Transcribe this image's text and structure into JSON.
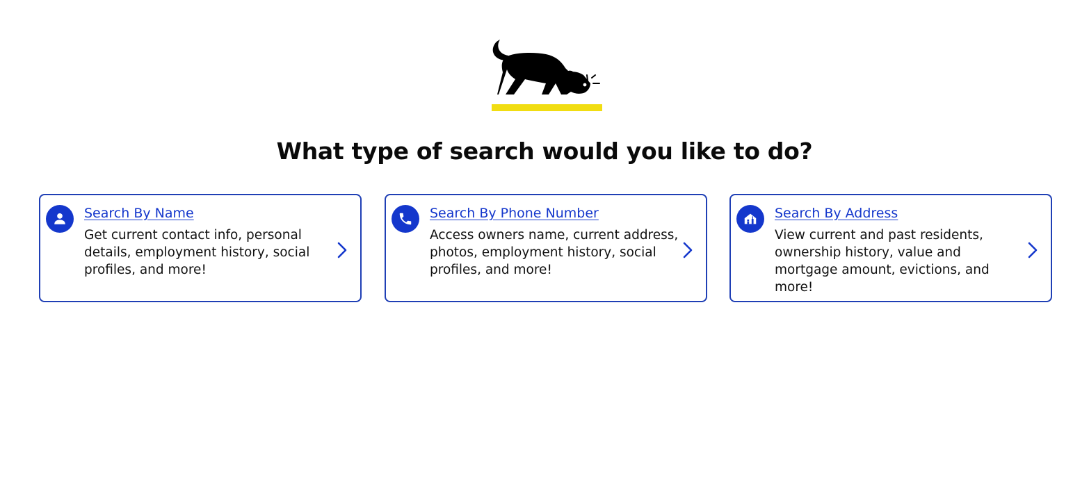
{
  "heading": "What type of search would you like to do?",
  "cards": [
    {
      "title": "Search By Name",
      "description": "Get current contact info, personal details, employment history, social profiles, and more!",
      "icon": "person-icon"
    },
    {
      "title": "Search By Phone Number",
      "description": "Access owners name, current address, photos, employment history, social profiles, and more!",
      "icon": "phone-icon"
    },
    {
      "title": "Search By Address",
      "description": "View current and past residents, ownership history, value and mortgage amount, evictions, and more!",
      "icon": "house-icon"
    }
  ],
  "colors": {
    "accent_blue": "#1437cc",
    "card_border": "#1f3fb5",
    "logo_underline": "#f1dd12",
    "logo_dog": "#000000"
  }
}
